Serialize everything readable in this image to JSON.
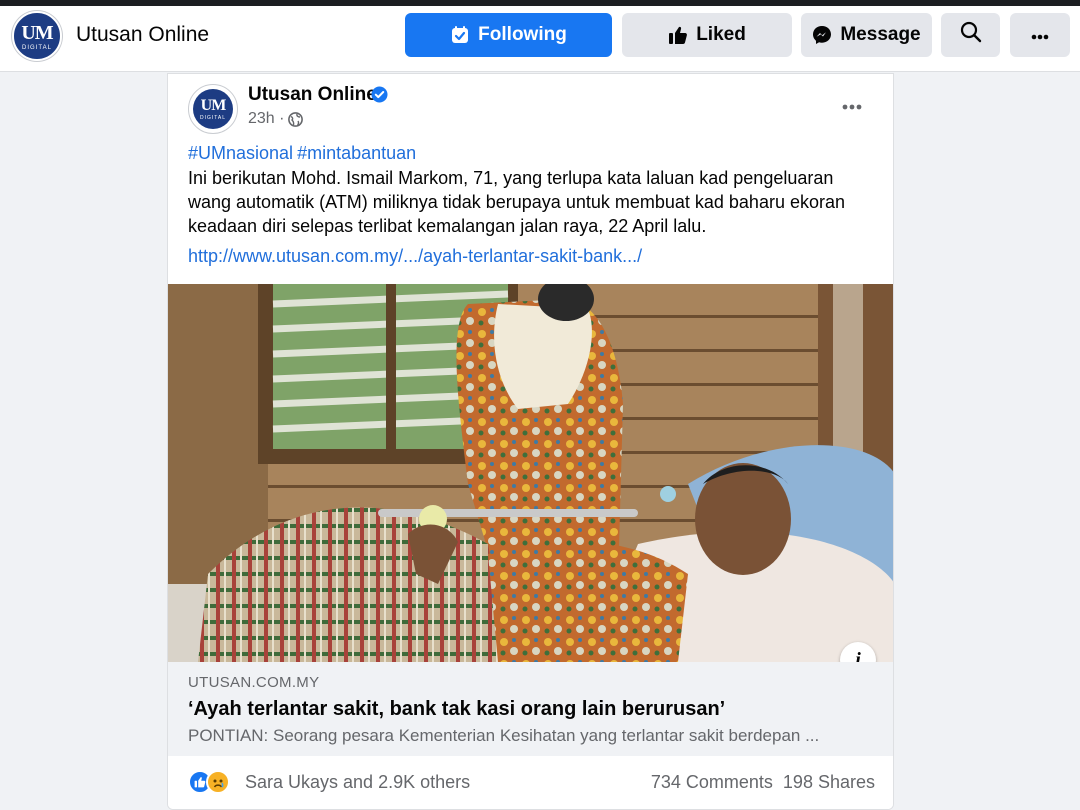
{
  "header": {
    "page_name": "Utusan Online",
    "logo_text": "UM",
    "logo_subtext": "DIGITAL",
    "following_label": "Following",
    "liked_label": "Liked",
    "message_label": "Message",
    "icons": {
      "following": "bookmark-check-icon",
      "liked": "thumbs-up-icon",
      "message": "messenger-icon",
      "search": "search-icon",
      "more": "more-dots-icon"
    }
  },
  "post": {
    "author": "Utusan Online",
    "verified": true,
    "time": "23h ·",
    "hashtags": [
      "#UMnasional",
      "#mintabantuan"
    ],
    "body": "Ini berikutan Mohd. Ismail Markom, 71, yang terlupa kata laluan kad pengeluaran wang automatik (ATM) miliknya tidak berupaya untuk membuat kad baharu ekoran keadaan diri selepas terlibat kemalangan jalan raya, 22 April lalu.",
    "link": "http://www.utusan.com.my/.../ayah-terlantar-sakit-bank.../",
    "link_card": {
      "domain": "UTUSAN.COM.MY",
      "title": "‘Ayah terlantar sakit, bank tak kasi orang lain berurusan’",
      "description": "PONTIAN: Seorang pesara Kementerian Kesihatan yang terlantar sakit berdepan ..."
    },
    "stats": {
      "reaction_names": "Sara Ukays and 2.9K others",
      "comments": "734 Comments",
      "shares": "198 Shares",
      "reactions": [
        "like",
        "sad"
      ]
    }
  },
  "colors": {
    "primary": "#1877f2",
    "link": "#216fdb",
    "secondary_text": "#65676b",
    "logo_navy": "#1d3c83"
  }
}
